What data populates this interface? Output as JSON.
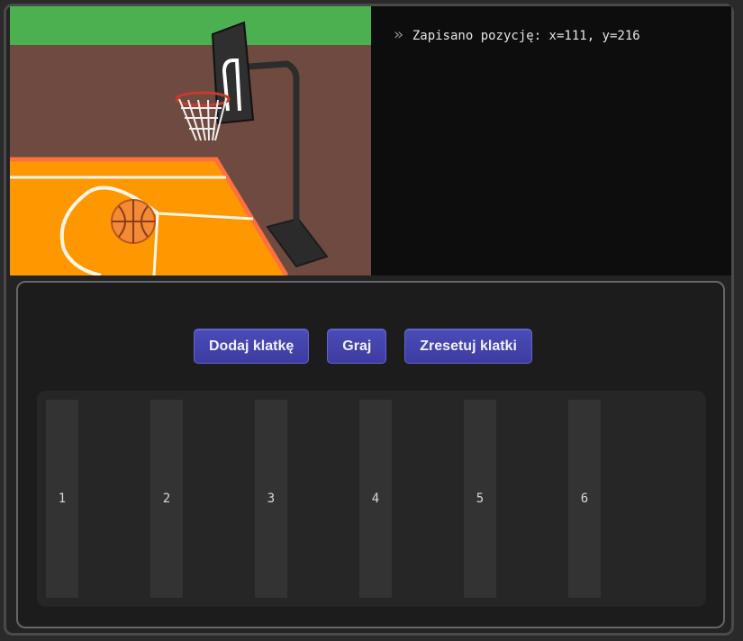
{
  "log": {
    "icon": "double-chevron-right-icon",
    "message": "Zapisano pozycję: x=111, y=216"
  },
  "buttons": {
    "add_frame": "Dodaj klatkę",
    "play": "Graj",
    "reset_frames": "Zresetuj klatki"
  },
  "frames": [
    {
      "label": "1"
    },
    {
      "label": "2"
    },
    {
      "label": "3"
    },
    {
      "label": "4"
    },
    {
      "label": "5"
    },
    {
      "label": "6"
    }
  ],
  "colors": {
    "grass": "#4caf50",
    "wall": "#6e4a41",
    "court": "#ff9800",
    "court_border": "#ff6f3f",
    "ball": "#f28a36",
    "button": "#4545b0",
    "log_background": "#0d0d0d"
  }
}
